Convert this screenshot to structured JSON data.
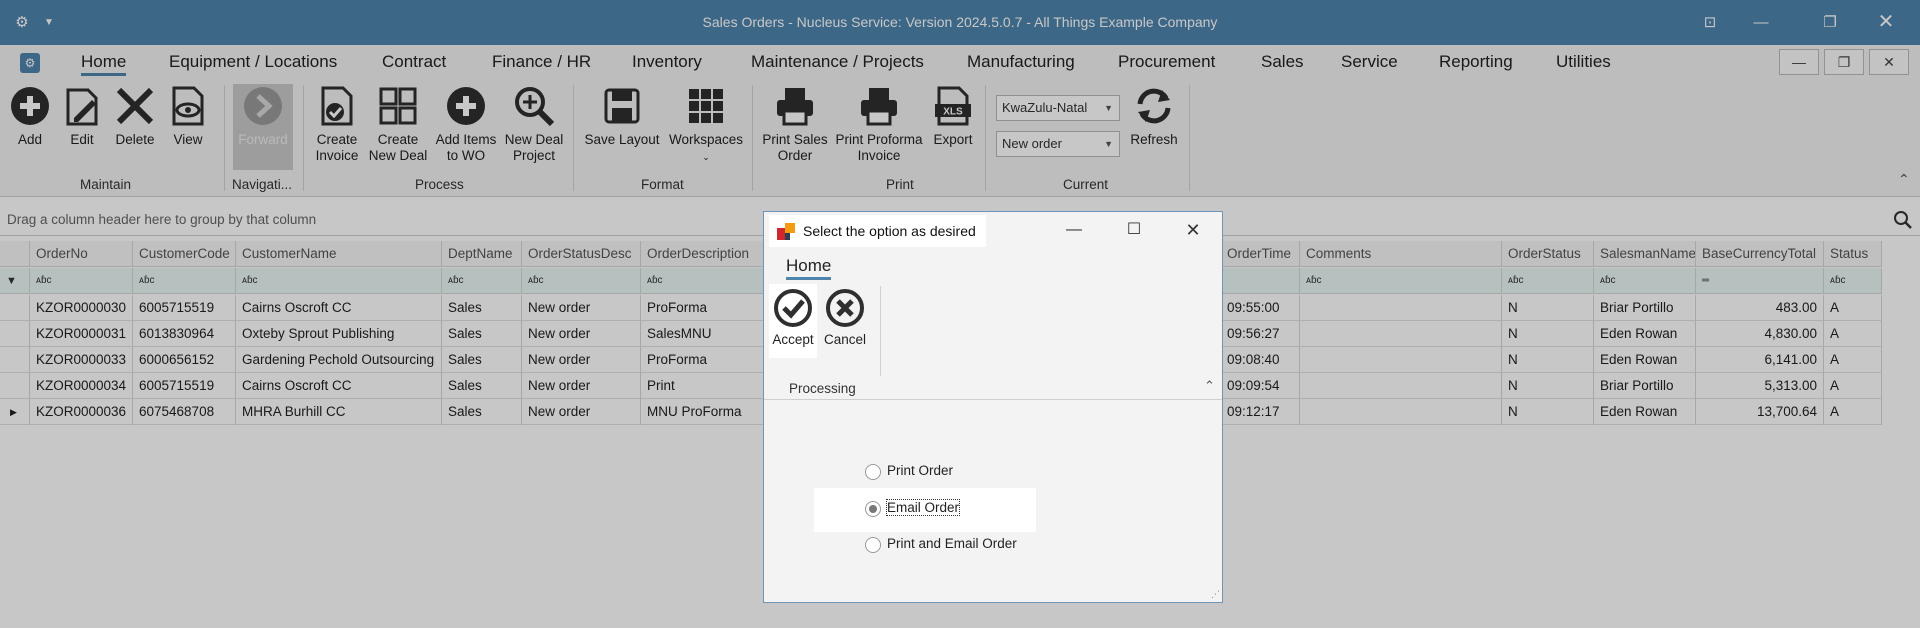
{
  "window": {
    "title": "Sales Orders - Nucleus Service: Version 2024.5.0.7 - All Things Example Company"
  },
  "menu": {
    "tabs": [
      "Home",
      "Equipment / Locations",
      "Contract",
      "Finance / HR",
      "Inventory",
      "Maintenance / Projects",
      "Manufacturing",
      "Procurement",
      "Sales",
      "Service",
      "Reporting",
      "Utilities"
    ]
  },
  "ribbon": {
    "buttons": {
      "add": "Add",
      "edit": "Edit",
      "delete": "Delete",
      "view": "View",
      "forward": "Forward",
      "create_invoice_1": "Create",
      "create_invoice_2": "Invoice",
      "create_deal_1": "Create",
      "create_deal_2": "New Deal",
      "add_items_1": "Add Items",
      "add_items_2": "to WO",
      "new_deal_project_1": "New Deal",
      "new_deal_project_2": "Project",
      "save_layout": "Save Layout",
      "workspaces": "Workspaces",
      "print_sales_order_1": "Print Sales",
      "print_sales_order_2": "Order",
      "print_proforma_1": "Print Proforma",
      "print_proforma_2": "Invoice",
      "export": "Export",
      "refresh": "Refresh"
    },
    "groups": {
      "maintain": "Maintain",
      "navigation": "Navigati...",
      "process": "Process",
      "format": "Format",
      "print": "Print",
      "current": "Current"
    },
    "region_select": "KwaZulu-Natal",
    "status_select": "New order"
  },
  "grid": {
    "group_hint": "Drag a column header here to group by that column",
    "headers": [
      "OrderNo",
      "CustomerCode",
      "CustomerName",
      "DeptName",
      "OrderStatusDesc",
      "OrderDescription",
      "OrderTime",
      "Comments",
      "OrderStatus",
      "SalesmanName",
      "BaseCurrencyTotal",
      "Status"
    ],
    "filter_glyph": "ᴀɓc",
    "rows": [
      {
        "order_no": "KZOR0000030",
        "customer_code": "6005715519",
        "customer_name": "Cairns Oscroft CC",
        "dept": "Sales",
        "status_desc": "New order",
        "description": "ProForma",
        "time": "09:55:00",
        "comments": "",
        "order_status": "N",
        "salesman": "Briar Portillo",
        "total": "483.00",
        "status": "A"
      },
      {
        "order_no": "KZOR0000031",
        "customer_code": "6013830964",
        "customer_name": "Oxteby Sprout Publishing",
        "dept": "Sales",
        "status_desc": "New order",
        "description": "SalesMNU",
        "time": "09:56:27",
        "comments": "",
        "order_status": "N",
        "salesman": "Eden Rowan",
        "total": "4,830.00",
        "status": "A"
      },
      {
        "order_no": "KZOR0000033",
        "customer_code": "6000656152",
        "customer_name": "Gardening Pechold Outsourcing",
        "dept": "Sales",
        "status_desc": "New order",
        "description": "ProForma",
        "time": "09:08:40",
        "comments": "",
        "order_status": "N",
        "salesman": "Eden Rowan",
        "total": "6,141.00",
        "status": "A"
      },
      {
        "order_no": "KZOR0000034",
        "customer_code": "6005715519",
        "customer_name": "Cairns Oscroft CC",
        "dept": "Sales",
        "status_desc": "New order",
        "description": "Print",
        "time": "09:09:54",
        "comments": "",
        "order_status": "N",
        "salesman": "Briar Portillo",
        "total": "5,313.00",
        "status": "A"
      },
      {
        "order_no": "KZOR0000036",
        "customer_code": "6075468708",
        "customer_name": "MHRA Burhill CC",
        "dept": "Sales",
        "status_desc": "New order",
        "description": "MNU ProForma",
        "time": "09:12:17",
        "comments": "",
        "order_status": "N",
        "salesman": "Eden Rowan",
        "total": "13,700.64",
        "status": "A"
      }
    ]
  },
  "dialog": {
    "title": "Select the option as desired",
    "tab": "Home",
    "accept": "Accept",
    "cancel": "Cancel",
    "group": "Processing",
    "options": [
      "Print Order",
      "Email Order",
      "Print and Email Order"
    ],
    "selected_option": "Email Order"
  },
  "colors": {
    "titlebar": "#4f84ad",
    "accent": "#4f84ad",
    "filter_row": "#eaf6f5"
  }
}
